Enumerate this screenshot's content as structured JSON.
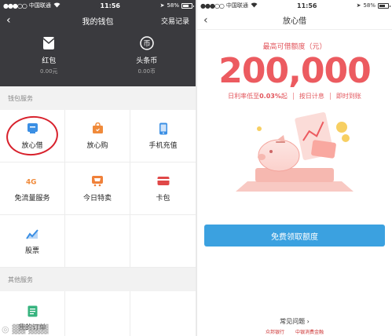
{
  "left": {
    "status": {
      "carrier": "中国联通",
      "time": "11:56",
      "battery": "58%"
    },
    "nav": {
      "back": "‹",
      "title": "我的钱包",
      "records": "交易记录"
    },
    "assets": [
      {
        "name": "红包",
        "value": "0.00元",
        "icon": "envelope-icon"
      },
      {
        "name": "头条币",
        "value": "0.00币",
        "icon": "coin-icon"
      }
    ],
    "wallet_services_title": "钱包服务",
    "services": [
      {
        "label": "放心借",
        "icon": "loan-card-icon",
        "color": "#3b8fe4"
      },
      {
        "label": "放心购",
        "icon": "shopping-bag-icon",
        "color": "#f08a3a"
      },
      {
        "label": "手机充值",
        "icon": "phone-icon",
        "color": "#3b8fe4"
      },
      {
        "label": "免流量服务",
        "icon": "4g-icon",
        "color": "#f08a3a"
      },
      {
        "label": "今日特卖",
        "icon": "sale-cart-icon",
        "color": "#f0813a"
      },
      {
        "label": "卡包",
        "icon": "card-wallet-icon",
        "color": "#e04848"
      },
      {
        "label": "股票",
        "icon": "stock-chart-icon",
        "color": "#3b8fe4"
      }
    ],
    "other_services_title": "其他服务",
    "other_services": [
      {
        "label": "我的订单",
        "icon": "order-list-icon",
        "color": "#36b37e"
      }
    ]
  },
  "right": {
    "status": {
      "carrier": "中国联通",
      "time": "11:56",
      "battery": "58%"
    },
    "nav": {
      "back": "‹",
      "title": "放心借"
    },
    "limit_label": "最高可借额度（元）",
    "limit_amount": "200,000",
    "features": {
      "rate_prefix": "日利率低至",
      "rate_value": "0.03%",
      "rate_suffix": "起",
      "daily_interest": "按日计息",
      "instant": "即时到账"
    },
    "cta_label": "免费领取额度",
    "faq_label": "常见问题 ›",
    "partners": [
      "众邦银行",
      "中银消费金融"
    ]
  },
  "colors": {
    "accent_blue": "#3ba1e0",
    "amount_red": "#ec5b60",
    "header_dark": "#3a3a3e",
    "highlight_ring": "#d8212c"
  }
}
